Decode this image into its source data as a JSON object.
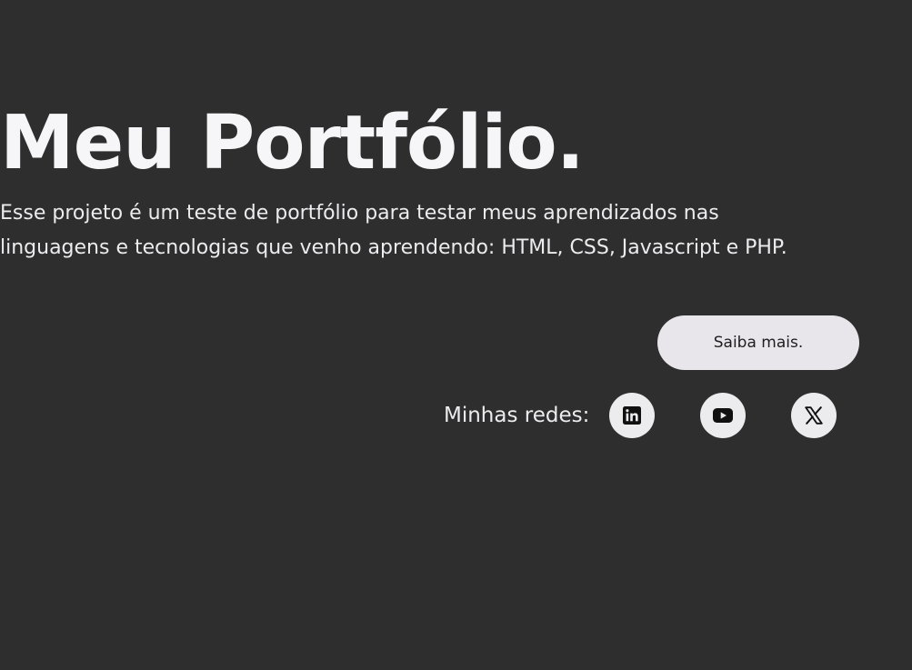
{
  "hero": {
    "title": "Meu Portfólio.",
    "description": "Esse projeto é um teste de portfólio para testar meus aprendizados nas linguagens e tecnologias que venho aprendendo: HTML, CSS, Javascript e PHP.",
    "cta_label": "Saiba mais."
  },
  "socials": {
    "label": "Minhas redes:",
    "items": [
      {
        "icon": "linkedin-icon"
      },
      {
        "icon": "youtube-icon"
      },
      {
        "icon": "x-icon"
      }
    ]
  },
  "colors": {
    "background": "#2e2e2e",
    "text": "#f4f4f6",
    "button_bg": "#e8e6eb",
    "icon": "#111111"
  }
}
